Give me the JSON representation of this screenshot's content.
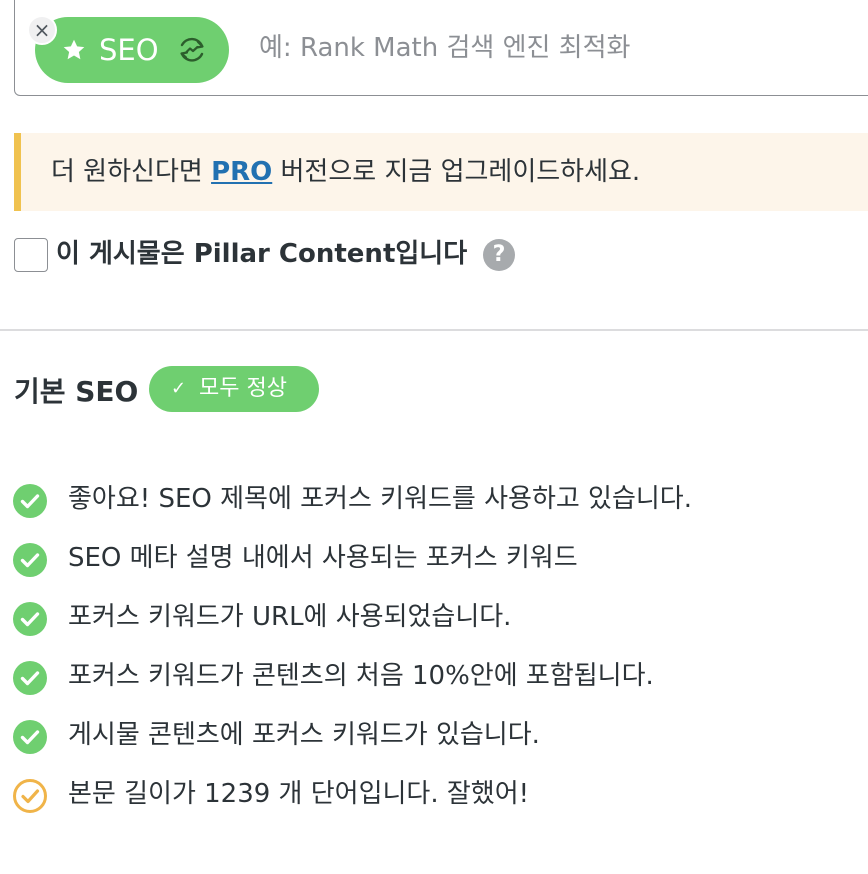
{
  "keyword": {
    "tag_label": "SEO",
    "remove_symbol": "×",
    "placeholder": "예: Rank Math 검색 엔진 최적화",
    "tag_color": "#6fcf70"
  },
  "notice": {
    "prefix": "더 원하신다면 ",
    "link": "PRO",
    "suffix": " 버전으로 지금 업그레이드하세요."
  },
  "pillar": {
    "label": "이 게시물은 Pillar Content입니다",
    "help_symbol": "?",
    "checked": false
  },
  "section": {
    "title": "기본 SEO",
    "badge_check": "✓",
    "badge_label": "모두 정상",
    "badge_color": "#6fcf70"
  },
  "checks": [
    {
      "text": "좋아요! SEO 제목에 포커스 키워드를 사용하고 있습니다.",
      "status": "pass",
      "icon": "check-circle-icon"
    },
    {
      "text": "SEO 메타 설명 내에서 사용되는 포커스 키워드",
      "status": "pass",
      "icon": "check-circle-icon"
    },
    {
      "text": "포커스 키워드가 URL에 사용되었습니다.",
      "status": "pass",
      "icon": "check-circle-icon"
    },
    {
      "text": "포커스 키워드가 콘텐츠의 처음 10%안에 포함됩니다.",
      "status": "pass",
      "icon": "check-circle-icon"
    },
    {
      "text": "게시물 콘텐츠에 포커스 키워드가 있습니다.",
      "status": "pass",
      "icon": "check-circle-icon"
    },
    {
      "text": "본문 길이가 1239 개 단어입니다. 잘했어!",
      "status": "ok",
      "icon": "check-circle-outline-icon"
    }
  ],
  "colors": {
    "pass": "#6fcf70",
    "ok": "#f0b449",
    "link": "#2271b1",
    "notice_bg": "#fdf5ea",
    "notice_border": "#f0c24f"
  }
}
